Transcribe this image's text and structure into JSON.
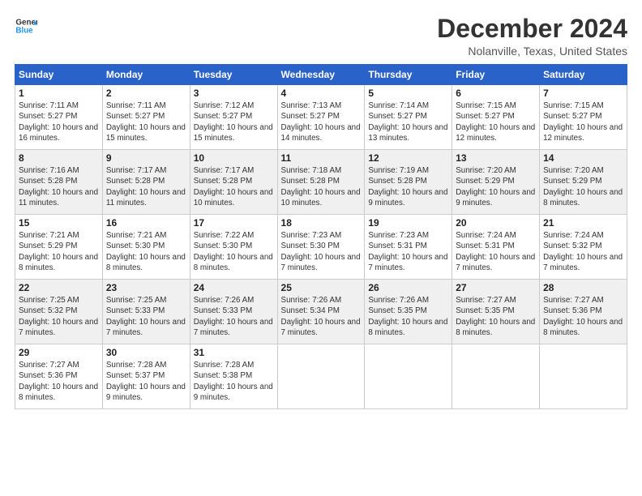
{
  "logo": {
    "line1": "General",
    "line2": "Blue"
  },
  "title": "December 2024",
  "location": "Nolanville, Texas, United States",
  "weekdays": [
    "Sunday",
    "Monday",
    "Tuesday",
    "Wednesday",
    "Thursday",
    "Friday",
    "Saturday"
  ],
  "weeks": [
    [
      {
        "day": 1,
        "rise": "7:11 AM",
        "set": "5:27 PM",
        "daylight": "10 hours and 16 minutes."
      },
      {
        "day": 2,
        "rise": "7:11 AM",
        "set": "5:27 PM",
        "daylight": "10 hours and 15 minutes."
      },
      {
        "day": 3,
        "rise": "7:12 AM",
        "set": "5:27 PM",
        "daylight": "10 hours and 15 minutes."
      },
      {
        "day": 4,
        "rise": "7:13 AM",
        "set": "5:27 PM",
        "daylight": "10 hours and 14 minutes."
      },
      {
        "day": 5,
        "rise": "7:14 AM",
        "set": "5:27 PM",
        "daylight": "10 hours and 13 minutes."
      },
      {
        "day": 6,
        "rise": "7:15 AM",
        "set": "5:27 PM",
        "daylight": "10 hours and 12 minutes."
      },
      {
        "day": 7,
        "rise": "7:15 AM",
        "set": "5:27 PM",
        "daylight": "10 hours and 12 minutes."
      }
    ],
    [
      {
        "day": 8,
        "rise": "7:16 AM",
        "set": "5:28 PM",
        "daylight": "10 hours and 11 minutes."
      },
      {
        "day": 9,
        "rise": "7:17 AM",
        "set": "5:28 PM",
        "daylight": "10 hours and 11 minutes."
      },
      {
        "day": 10,
        "rise": "7:17 AM",
        "set": "5:28 PM",
        "daylight": "10 hours and 10 minutes."
      },
      {
        "day": 11,
        "rise": "7:18 AM",
        "set": "5:28 PM",
        "daylight": "10 hours and 10 minutes."
      },
      {
        "day": 12,
        "rise": "7:19 AM",
        "set": "5:28 PM",
        "daylight": "10 hours and 9 minutes."
      },
      {
        "day": 13,
        "rise": "7:20 AM",
        "set": "5:29 PM",
        "daylight": "10 hours and 9 minutes."
      },
      {
        "day": 14,
        "rise": "7:20 AM",
        "set": "5:29 PM",
        "daylight": "10 hours and 8 minutes."
      }
    ],
    [
      {
        "day": 15,
        "rise": "7:21 AM",
        "set": "5:29 PM",
        "daylight": "10 hours and 8 minutes."
      },
      {
        "day": 16,
        "rise": "7:21 AM",
        "set": "5:30 PM",
        "daylight": "10 hours and 8 minutes."
      },
      {
        "day": 17,
        "rise": "7:22 AM",
        "set": "5:30 PM",
        "daylight": "10 hours and 8 minutes."
      },
      {
        "day": 18,
        "rise": "7:23 AM",
        "set": "5:30 PM",
        "daylight": "10 hours and 7 minutes."
      },
      {
        "day": 19,
        "rise": "7:23 AM",
        "set": "5:31 PM",
        "daylight": "10 hours and 7 minutes."
      },
      {
        "day": 20,
        "rise": "7:24 AM",
        "set": "5:31 PM",
        "daylight": "10 hours and 7 minutes."
      },
      {
        "day": 21,
        "rise": "7:24 AM",
        "set": "5:32 PM",
        "daylight": "10 hours and 7 minutes."
      }
    ],
    [
      {
        "day": 22,
        "rise": "7:25 AM",
        "set": "5:32 PM",
        "daylight": "10 hours and 7 minutes."
      },
      {
        "day": 23,
        "rise": "7:25 AM",
        "set": "5:33 PM",
        "daylight": "10 hours and 7 minutes."
      },
      {
        "day": 24,
        "rise": "7:26 AM",
        "set": "5:33 PM",
        "daylight": "10 hours and 7 minutes."
      },
      {
        "day": 25,
        "rise": "7:26 AM",
        "set": "5:34 PM",
        "daylight": "10 hours and 7 minutes."
      },
      {
        "day": 26,
        "rise": "7:26 AM",
        "set": "5:35 PM",
        "daylight": "10 hours and 8 minutes."
      },
      {
        "day": 27,
        "rise": "7:27 AM",
        "set": "5:35 PM",
        "daylight": "10 hours and 8 minutes."
      },
      {
        "day": 28,
        "rise": "7:27 AM",
        "set": "5:36 PM",
        "daylight": "10 hours and 8 minutes."
      }
    ],
    [
      {
        "day": 29,
        "rise": "7:27 AM",
        "set": "5:36 PM",
        "daylight": "10 hours and 8 minutes."
      },
      {
        "day": 30,
        "rise": "7:28 AM",
        "set": "5:37 PM",
        "daylight": "10 hours and 9 minutes."
      },
      {
        "day": 31,
        "rise": "7:28 AM",
        "set": "5:38 PM",
        "daylight": "10 hours and 9 minutes."
      },
      null,
      null,
      null,
      null
    ]
  ]
}
